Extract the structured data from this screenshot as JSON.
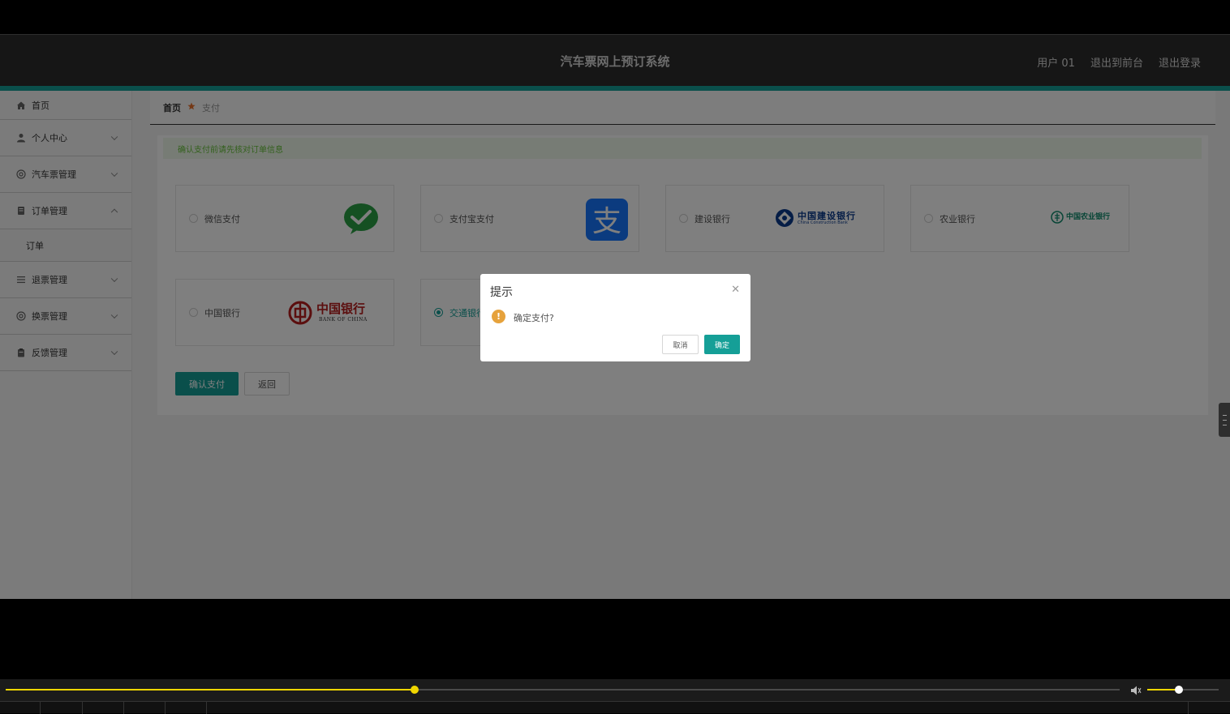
{
  "header": {
    "title": "汽车票网上预订系统",
    "user": "用户 01",
    "exit_front": "退出到前台",
    "logout": "退出登录"
  },
  "sidebar": {
    "items": [
      {
        "label": "首页",
        "icon": "home-icon"
      },
      {
        "label": "个人中心",
        "icon": "user-icon"
      },
      {
        "label": "汽车票管理",
        "icon": "settings-circle-icon"
      },
      {
        "label": "订单管理",
        "icon": "document-icon"
      },
      {
        "label": "退票管理",
        "icon": "list-icon"
      },
      {
        "label": "换票管理",
        "icon": "settings-circle-icon"
      },
      {
        "label": "反馈管理",
        "icon": "clipboard-icon"
      }
    ],
    "order_sub": "订单"
  },
  "breadcrumb": {
    "home": "首页",
    "current": "支付"
  },
  "notice": "确认支付前请先核对订单信息",
  "payment_methods": [
    {
      "label": "微信支付",
      "logo": "wechat-pay-logo",
      "selected": false
    },
    {
      "label": "支付宝支付",
      "logo": "alipay-logo",
      "selected": false
    },
    {
      "label": "建设银行",
      "logo": "ccb-logo",
      "selected": false
    },
    {
      "label": "农业银行",
      "logo": "abc-logo",
      "selected": false
    },
    {
      "label": "中国银行",
      "logo": "boc-logo",
      "selected": false
    },
    {
      "label": "交通银行",
      "logo": "bocom-logo",
      "selected": true
    }
  ],
  "logos": {
    "ccb_cn": "中国建设银行",
    "ccb_en": "China Construction Bank",
    "abc_cn": "中国农业银行",
    "boc_cn": "中国银行",
    "boc_en": "BANK OF CHINA"
  },
  "buttons": {
    "confirm_pay": "确认支付",
    "back": "返回"
  },
  "dialog": {
    "title": "提示",
    "message": "确定支付?",
    "cancel": "取消",
    "ok": "确定"
  },
  "player": {
    "progress": 0.367,
    "volume": 0.44
  },
  "colors": {
    "accent": "#159f97",
    "header": "#2d2d2d",
    "warning": "#e6a23c",
    "seek": "#f0d600"
  }
}
